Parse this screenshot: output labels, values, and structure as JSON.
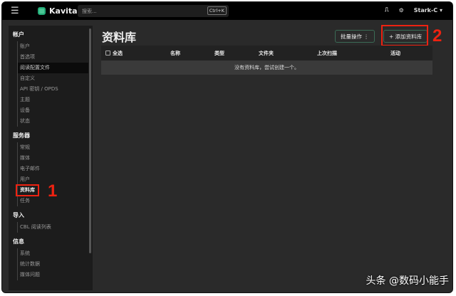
{
  "app": {
    "name": "Kavita",
    "search_placeholder": "搜索...",
    "shortcut": "Ctrl+K",
    "user": "Stark-C"
  },
  "sidebar": {
    "sections": [
      {
        "title": "帐户",
        "items": [
          "账户",
          "首选项",
          "阅读配置文件",
          "自定义",
          "API 密钥 / OPDS",
          "主题",
          "设备",
          "状态"
        ]
      },
      {
        "title": "服务器",
        "items": [
          "常规",
          "媒体",
          "电子邮件",
          "用户",
          "资料库",
          "任务"
        ]
      },
      {
        "title": "导入",
        "items": [
          "CBL 阅读列表"
        ]
      },
      {
        "title": "信息",
        "items": [
          "系统",
          "统计数据",
          "媒体问题"
        ]
      }
    ]
  },
  "main": {
    "title": "资料库",
    "bulk_label": "批量操作",
    "add_label": "添加资料库",
    "columns": [
      "全选",
      "名称",
      "类型",
      "文件夹",
      "上次扫描",
      "活动"
    ],
    "empty_text": "没有资料库，尝试创建一个。"
  },
  "annotations": [
    "1",
    "2"
  ],
  "watermark": "头条 @数码小能手"
}
